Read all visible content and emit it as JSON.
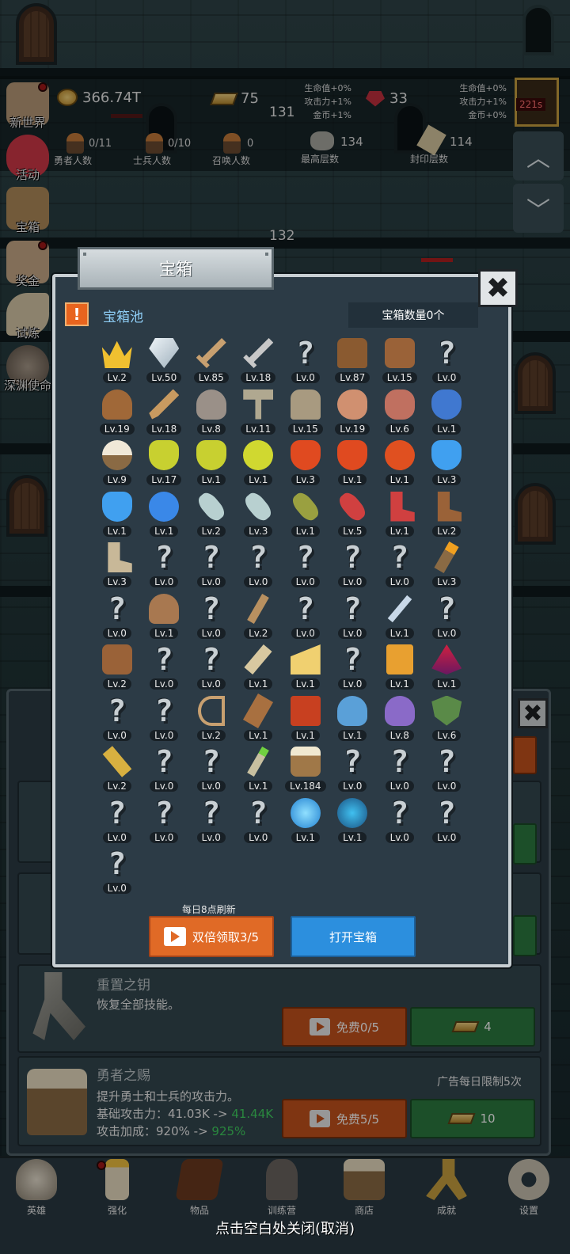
{
  "top_stats": {
    "gold": "366.74T",
    "gold_bars": "75",
    "gems": "33",
    "left_bonus": [
      "生命值+0%",
      "攻击力+1%",
      "金币+1%"
    ],
    "right_bonus": [
      "生命值+0%",
      "攻击力+1%",
      "金币+0%"
    ],
    "floor_a": "131",
    "floor_b": "132",
    "heroes_count": "0/11",
    "heroes_label": "勇者人数",
    "soldiers_count": "0/10",
    "soldiers_label": "士兵人数",
    "summon_count": "0",
    "summon_label": "召唤人数",
    "max_floor_count": "134",
    "max_floor_label": "最高层数",
    "sealed_count": "114",
    "sealed_label": "封印层数",
    "boss_timer": "221s"
  },
  "side_menu": {
    "items": [
      {
        "label": "新世界",
        "has_dot": true
      },
      {
        "label": "活动",
        "has_dot": false
      },
      {
        "label": "宝箱",
        "has_dot": false
      },
      {
        "label": "奖金",
        "has_dot": true
      },
      {
        "label": "试炼",
        "has_dot": false
      },
      {
        "label": "深渊使命",
        "has_dot": false
      }
    ]
  },
  "modal": {
    "title": "宝箱",
    "pool_title": "宝箱池",
    "warn_symbol": "!",
    "count_label": "宝箱数量0个",
    "close_symbol": "✖",
    "refresh_note": "每日8点刷新",
    "double_button": "双倍领取3/5",
    "open_button": "打开宝箱",
    "items": [
      {
        "icon": "crown-icon",
        "level": "Lv.2"
      },
      {
        "icon": "diamond-icon",
        "level": "Lv.50"
      },
      {
        "icon": "sword-icon",
        "level": "Lv.85"
      },
      {
        "icon": "steel-sword-icon",
        "level": "Lv.18"
      },
      {
        "icon": "unknown-icon",
        "level": "Lv.0"
      },
      {
        "icon": "leather-armor-icon",
        "level": "Lv.87"
      },
      {
        "icon": "backpack-armor-icon",
        "level": "Lv.15"
      },
      {
        "icon": "unknown-icon",
        "level": "Lv.0"
      },
      {
        "icon": "leather-helmet-icon",
        "level": "Lv.19"
      },
      {
        "icon": "dagger-icon",
        "level": "Lv.18"
      },
      {
        "icon": "knight-helmet-icon",
        "level": "Lv.8"
      },
      {
        "icon": "hammer-icon",
        "level": "Lv.11"
      },
      {
        "icon": "great-helm-icon",
        "level": "Lv.15"
      },
      {
        "icon": "meat-icon",
        "level": "Lv.19"
      },
      {
        "icon": "steak-icon",
        "level": "Lv.6"
      },
      {
        "icon": "blue-bag-icon",
        "level": "Lv.1"
      },
      {
        "icon": "flour-bowl-icon",
        "level": "Lv.9"
      },
      {
        "icon": "yellow-potion-icon",
        "level": "Lv.17"
      },
      {
        "icon": "yellow-potion-icon",
        "level": "Lv.1"
      },
      {
        "icon": "yellow-flask-icon",
        "level": "Lv.1"
      },
      {
        "icon": "red-potion-icon",
        "level": "Lv.3"
      },
      {
        "icon": "red-potion-icon",
        "level": "Lv.1"
      },
      {
        "icon": "red-flask-icon",
        "level": "Lv.1"
      },
      {
        "icon": "blue-potion-icon",
        "level": "Lv.3"
      },
      {
        "icon": "blue-potion-icon",
        "level": "Lv.1"
      },
      {
        "icon": "blue-flask-icon",
        "level": "Lv.1"
      },
      {
        "icon": "white-vial-icon",
        "level": "Lv.2"
      },
      {
        "icon": "white-vial-icon",
        "level": "Lv.3"
      },
      {
        "icon": "green-bottle-icon",
        "level": "Lv.1"
      },
      {
        "icon": "red-bottle-icon",
        "level": "Lv.5"
      },
      {
        "icon": "winged-boot-icon",
        "level": "Lv.1"
      },
      {
        "icon": "boot-icon",
        "level": "Lv.2"
      },
      {
        "icon": "cloth-boot-icon",
        "level": "Lv.3"
      },
      {
        "icon": "unknown-icon",
        "level": "Lv.0"
      },
      {
        "icon": "unknown-icon",
        "level": "Lv.0"
      },
      {
        "icon": "unknown-icon",
        "level": "Lv.0"
      },
      {
        "icon": "unknown-icon",
        "level": "Lv.0"
      },
      {
        "icon": "unknown-icon",
        "level": "Lv.0"
      },
      {
        "icon": "unknown-icon",
        "level": "Lv.0"
      },
      {
        "icon": "torch-icon",
        "level": "Lv.3"
      },
      {
        "icon": "unknown-icon",
        "level": "Lv.0"
      },
      {
        "icon": "mushroom-icon",
        "level": "Lv.1"
      },
      {
        "icon": "unknown-icon",
        "level": "Lv.0"
      },
      {
        "icon": "wooden-staff-icon",
        "level": "Lv.2"
      },
      {
        "icon": "unknown-icon",
        "level": "Lv.0"
      },
      {
        "icon": "unknown-icon",
        "level": "Lv.0"
      },
      {
        "icon": "crystal-wand-icon",
        "level": "Lv.1"
      },
      {
        "icon": "unknown-icon",
        "level": "Lv.0"
      },
      {
        "icon": "satchel-icon",
        "level": "Lv.2"
      },
      {
        "icon": "unknown-icon",
        "level": "Lv.0"
      },
      {
        "icon": "unknown-icon",
        "level": "Lv.0"
      },
      {
        "icon": "bone-club-icon",
        "level": "Lv.1"
      },
      {
        "icon": "cheese-icon",
        "level": "Lv.1"
      },
      {
        "icon": "unknown-icon",
        "level": "Lv.0"
      },
      {
        "icon": "honey-jar-icon",
        "level": "Lv.1"
      },
      {
        "icon": "red-crystal-icon",
        "level": "Lv.1"
      },
      {
        "icon": "unknown-icon",
        "level": "Lv.0"
      },
      {
        "icon": "unknown-icon",
        "level": "Lv.0"
      },
      {
        "icon": "bow-icon",
        "level": "Lv.2"
      },
      {
        "icon": "quiver-icon",
        "level": "Lv.1"
      },
      {
        "icon": "fire-book-icon",
        "level": "Lv.1"
      },
      {
        "icon": "ghost-blue-icon",
        "level": "Lv.1"
      },
      {
        "icon": "ghost-purple-icon",
        "level": "Lv.8"
      },
      {
        "icon": "emblem-shield-icon",
        "level": "Lv.6"
      },
      {
        "icon": "jeweled-scroll-icon",
        "level": "Lv.2"
      },
      {
        "icon": "unknown-icon",
        "level": "Lv.0"
      },
      {
        "icon": "unknown-icon",
        "level": "Lv.0"
      },
      {
        "icon": "green-orb-staff-icon",
        "level": "Lv.1"
      },
      {
        "icon": "beer-mug-icon",
        "level": "Lv.184"
      },
      {
        "icon": "unknown-icon",
        "level": "Lv.0"
      },
      {
        "icon": "unknown-icon",
        "level": "Lv.0"
      },
      {
        "icon": "unknown-icon",
        "level": "Lv.0"
      },
      {
        "icon": "unknown-icon",
        "level": "Lv.0"
      },
      {
        "icon": "unknown-icon",
        "level": "Lv.0"
      },
      {
        "icon": "unknown-icon",
        "level": "Lv.0"
      },
      {
        "icon": "unknown-icon",
        "level": "Lv.0"
      },
      {
        "icon": "blue-orb-pedestal-icon",
        "level": "Lv.1"
      },
      {
        "icon": "rune-compass-icon",
        "level": "Lv.1"
      },
      {
        "icon": "unknown-icon",
        "level": "Lv.0"
      },
      {
        "icon": "unknown-icon",
        "level": "Lv.0"
      },
      {
        "icon": "unknown-icon",
        "level": "Lv.0"
      }
    ]
  },
  "shop": {
    "reset_key": {
      "title": "重置之钥",
      "desc": "恢复全部技能。",
      "free_label": "免费0/5",
      "price": "4"
    },
    "hero_gift": {
      "title": "勇者之赐",
      "desc": "提升勇士和士兵的攻击力。",
      "base_attack_label": "基础攻击力：41.03K ->",
      "base_attack_new": "41.44K",
      "bonus_label": "攻击加成：920% ->",
      "bonus_new": "925%",
      "ad_limit": "广告每日限制5次",
      "free_label": "免费5/5",
      "price": "10"
    }
  },
  "bottom_nav": {
    "items": [
      "英雄",
      "强化",
      "物品",
      "训练营",
      "商店",
      "成就",
      "设置"
    ]
  },
  "close_hint": "点击空白处关闭(取消)",
  "colors": {
    "accent_orange": "#e06a26",
    "accent_blue": "#2c8fde",
    "green_button": "#2c7a40",
    "pool_title": "#8ecdf5",
    "value_up_green": "#40d060"
  }
}
